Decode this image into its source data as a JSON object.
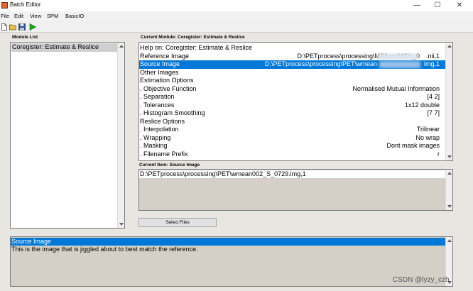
{
  "window": {
    "title": "Batch Editor",
    "controls": {
      "minimize": "—",
      "maximize": "☐",
      "close": "✕"
    }
  },
  "menubar": [
    "File",
    "Edit",
    "View",
    "SPM",
    "BasicIO"
  ],
  "module_list": {
    "label": "Module List",
    "items": [
      "Coregister: Estimate & Reslice"
    ]
  },
  "current_module": {
    "label": "Current Module: Coregister: Estimate & Reslice",
    "rows": [
      {
        "label": "Help on: Coregister: Estimate & Reslice",
        "value": ""
      },
      {
        "label": "Reference Image",
        "value": "D:\\PETprocess\\processing\\MRI\\wmMClc_0",
        "value2": ".nii,1"
      },
      {
        "label": "Source Image",
        "value": "D:\\PETprocess\\processing\\PET\\wmean",
        "value2": "img,1",
        "selected": true
      },
      {
        "label": "Other Images",
        "value": ""
      },
      {
        "label": "Estimation Options",
        "value": ""
      },
      {
        "label": ". Objective Function",
        "value": "Normalised Mutual Information"
      },
      {
        "label": ". Separation",
        "value": "[4 2]"
      },
      {
        "label": ". Tolerances",
        "value": "1x12 double"
      },
      {
        "label": ". Histogram Smoothing",
        "value": "[7 7]"
      },
      {
        "label": "Reslice Options",
        "value": ""
      },
      {
        "label": ". Interpolation",
        "value": "Trilinear"
      },
      {
        "label": ". Wrapping",
        "value": "No wrap"
      },
      {
        "label": ". Masking",
        "value": "Dont mask images"
      },
      {
        "label": ". Filename Prefix",
        "value": "r"
      }
    ]
  },
  "current_item": {
    "label": "Current Item: Source Image",
    "value": "D:\\PETprocess\\processing\\PET\\wmean002_S_0729.img,1"
  },
  "select_files_label": "Select Files",
  "help": {
    "title": "Source Image",
    "text": "This is the image that is jiggled about to best match the reference."
  },
  "watermark": "CSDN @lyzy_czh",
  "colors": {
    "selection": "#0078d7",
    "panel_gray": "#d4d0c8",
    "run_green": "#1faa1f"
  }
}
